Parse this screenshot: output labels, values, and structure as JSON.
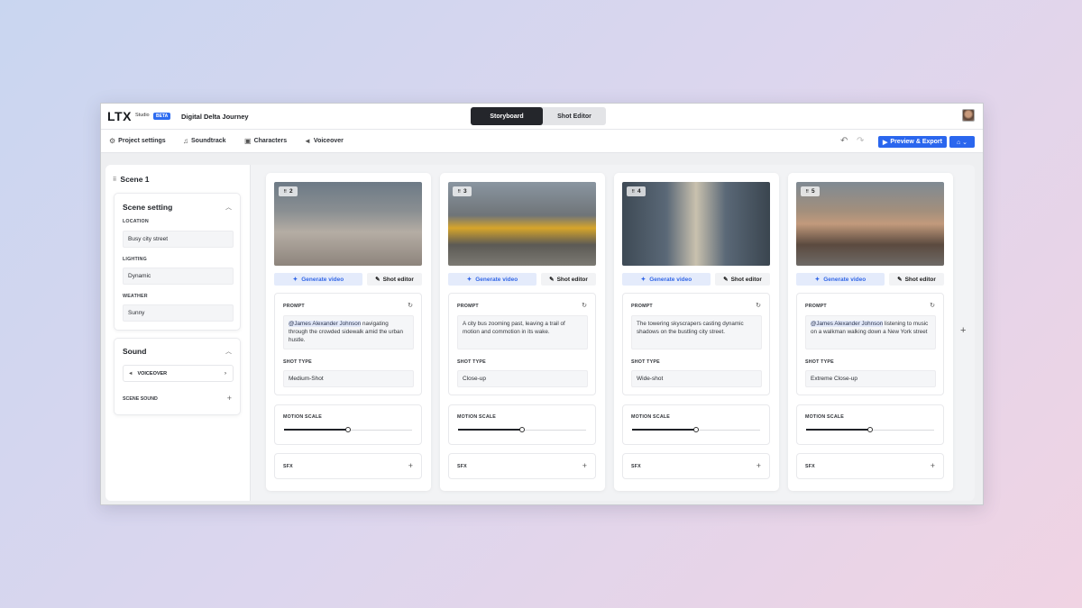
{
  "app": {
    "logo": "LTX",
    "logo_sub": "Studio",
    "beta": "BETA",
    "project_title": "Digital Delta Journey"
  },
  "view_tabs": {
    "active": "Storyboard",
    "inactive": "Shot Editor"
  },
  "toolbar": {
    "items": [
      {
        "label": "Project settings",
        "icon": "gear-icon"
      },
      {
        "label": "Soundtrack",
        "icon": "music-icon"
      },
      {
        "label": "Characters",
        "icon": "characters-icon"
      },
      {
        "label": "Voiceover",
        "icon": "voiceover-icon"
      }
    ],
    "export_label": "Preview & Export"
  },
  "sidebar": {
    "scene_title": "Scene 1",
    "scene_setting": {
      "title": "Scene setting",
      "location_label": "LOCATION",
      "location": "Busy city street",
      "lighting_label": "LIGHTING",
      "lighting": "Dynamic",
      "weather_label": "WEATHER",
      "weather": "Sunny"
    },
    "sound": {
      "title": "Sound",
      "voiceover": "VOICEOVER",
      "scene_sound": "SCENE SOUND"
    }
  },
  "labels": {
    "generate_video": "Generate video",
    "shot_editor": "Shot editor",
    "prompt": "PROMPT",
    "shot_type": "SHOT TYPE",
    "motion_scale": "MOTION SCALE",
    "sfx": "SFX"
  },
  "shots": [
    {
      "number": "2",
      "mention": "@James Alexander Johnson",
      "prompt": " navigating through the crowded sidewalk amid the urban hustle.",
      "shot_type": "Medium-Shot",
      "motion_scale": 0.5
    },
    {
      "number": "3",
      "mention": "",
      "prompt": "A city bus zooming past, leaving a trail of motion and commotion in its wake.",
      "shot_type": "Close-up",
      "motion_scale": 0.5
    },
    {
      "number": "4",
      "mention": "",
      "prompt": "The towering skyscrapers casting dynamic shadows on the bustling city street.",
      "shot_type": "Wide-shot",
      "motion_scale": 0.5
    },
    {
      "number": "5",
      "mention": "@James Alexander Johnson",
      "prompt": " listening to music on a walkman walking down a New York street",
      "shot_type": "Extreme Close-up",
      "motion_scale": 0.5
    }
  ],
  "colors": {
    "accent": "#2a66ee",
    "dark_tab": "#24262b"
  }
}
